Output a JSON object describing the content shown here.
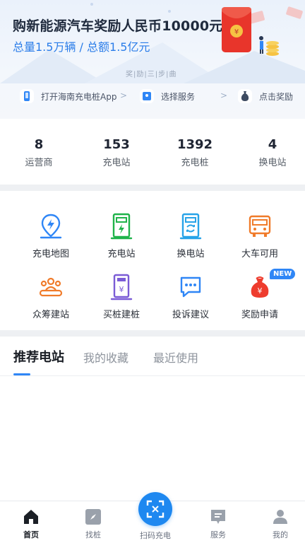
{
  "banner": {
    "title": "购新能源汽车奖励人民币10000元",
    "subtitle": "总量1.5万辆 / 总额1.5亿元",
    "steps_caption": "奖|励|三|步|曲"
  },
  "steps": [
    {
      "label": "打开海南充电桩App",
      "icon": "phone-icon"
    },
    {
      "label": "选择服务",
      "icon": "service-icon"
    },
    {
      "label": "点击奖励",
      "icon": "money-bag-icon"
    }
  ],
  "stats": [
    {
      "value": "8",
      "label": "运营商"
    },
    {
      "value": "153",
      "label": "充电站"
    },
    {
      "value": "1392",
      "label": "充电桩"
    },
    {
      "value": "4",
      "label": "换电站"
    }
  ],
  "grid": [
    {
      "label": "充电地图",
      "icon": "map-pin-icon"
    },
    {
      "label": "充电站",
      "icon": "charging-station-icon"
    },
    {
      "label": "换电站",
      "icon": "battery-swap-icon"
    },
    {
      "label": "大车可用",
      "icon": "bus-icon"
    },
    {
      "label": "众筹建站",
      "icon": "crowd-icon"
    },
    {
      "label": "买桩建桩",
      "icon": "buy-pile-icon"
    },
    {
      "label": "投诉建议",
      "icon": "feedback-icon"
    },
    {
      "label": "奖励申请",
      "icon": "reward-bag-icon"
    }
  ],
  "new_badge": "NEW",
  "tabs": [
    {
      "label": "推荐电站",
      "active": true
    },
    {
      "label": "我的收藏",
      "active": false
    },
    {
      "label": "最近使用",
      "active": false
    }
  ],
  "nav": [
    {
      "label": "首页",
      "icon": "home-icon",
      "active": true
    },
    {
      "label": "找桩",
      "icon": "compass-icon",
      "active": false
    },
    {
      "label": "扫码充电",
      "icon": "scan-icon",
      "active": false
    },
    {
      "label": "服务",
      "icon": "service-icon",
      "active": false
    },
    {
      "label": "我的",
      "icon": "profile-icon",
      "active": false
    }
  ],
  "colors": {
    "accent": "#2f86f6",
    "scan": "#1e88f0",
    "green": "#1fb34a",
    "orange": "#f07b2a",
    "purple": "#7b5cd6",
    "red": "#ee3c2e"
  }
}
